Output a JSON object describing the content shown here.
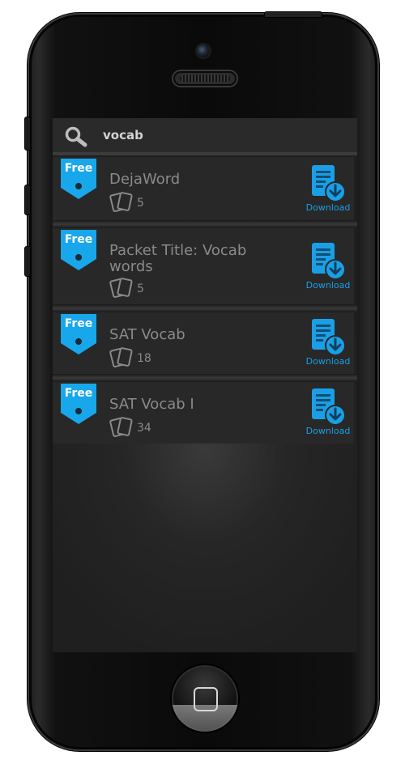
{
  "search": {
    "query": "vocab"
  },
  "results": [
    {
      "badge": "Free",
      "title": "DejaWord",
      "count": "5",
      "action": "Download"
    },
    {
      "badge": "Free",
      "title": "Packet Title: Vocab words",
      "count": "5",
      "action": "Download"
    },
    {
      "badge": "Free",
      "title": "SAT Vocab",
      "count": "18",
      "action": "Download"
    },
    {
      "badge": "Free",
      "title": "SAT Vocab I",
      "count": "34",
      "action": "Download"
    }
  ],
  "colors": {
    "accent": "#1a9fe6",
    "screen_bg": "#242424",
    "row_text": "#8a8a8a"
  },
  "icons": [
    "search-icon",
    "free-tag-icon",
    "cards-icon",
    "download-icon"
  ]
}
